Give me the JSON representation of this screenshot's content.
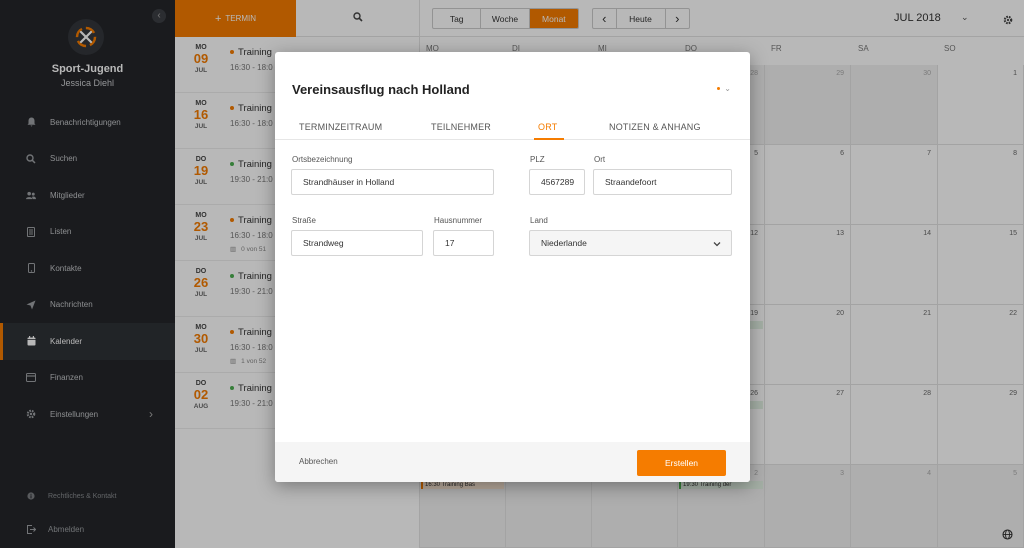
{
  "app": {
    "club_name": "Sport-Jugend",
    "user_name": "Jessica Diehl"
  },
  "sidebar": {
    "items": [
      {
        "label": "Benachrichtigungen",
        "icon": "bell-icon"
      },
      {
        "label": "Suchen",
        "icon": "search-icon"
      },
      {
        "label": "Mitglieder",
        "icon": "users-icon"
      },
      {
        "label": "Listen",
        "icon": "list-icon"
      },
      {
        "label": "Kontakte",
        "icon": "phone-icon"
      },
      {
        "label": "Nachrichten",
        "icon": "send-icon"
      },
      {
        "label": "Kalender",
        "icon": "calendar-icon",
        "active": true
      },
      {
        "label": "Finanzen",
        "icon": "finance-icon"
      },
      {
        "label": "Einstellungen",
        "icon": "gear-icon"
      }
    ],
    "footer_legal": "Rechtliches & Kontakt",
    "footer_logout": "Abmelden"
  },
  "event_list": {
    "add_label": "TERMIN",
    "items": [
      {
        "dow": "MO",
        "day": "09",
        "month": "JUL",
        "title": "Training",
        "time": "16:30 - 18:0",
        "meta": "",
        "color": "#f57c00"
      },
      {
        "dow": "MO",
        "day": "16",
        "month": "JUL",
        "title": "Training I",
        "time": "16:30 - 18:0",
        "meta": "",
        "color": "#f57c00"
      },
      {
        "dow": "DO",
        "day": "19",
        "month": "JUL",
        "title": "Training d",
        "time": "19:30 - 21:0",
        "meta": "",
        "color": "#4caf50"
      },
      {
        "dow": "MO",
        "day": "23",
        "month": "JUL",
        "title": "Training",
        "time": "16:30 - 18:0",
        "meta": "0 von 51",
        "color": "#f57c00"
      },
      {
        "dow": "DO",
        "day": "26",
        "month": "JUL",
        "title": "Training",
        "time": "19:30 - 21:0",
        "meta": "",
        "color": "#4caf50"
      },
      {
        "dow": "MO",
        "day": "30",
        "month": "JUL",
        "title": "Training",
        "time": "16:30 - 18:0",
        "meta": "1 von 52",
        "color": "#f57c00"
      },
      {
        "dow": "DO",
        "day": "02",
        "month": "AUG",
        "title": "Training",
        "time": "19:30 - 21:0",
        "meta": "",
        "color": "#4caf50"
      }
    ]
  },
  "calendar": {
    "views": [
      "Tag",
      "Woche",
      "Monat"
    ],
    "active_view": "Monat",
    "today_label": "Heute",
    "month_label": "JUL 2018",
    "weekdays": [
      "MO",
      "DI",
      "MI",
      "DO",
      "FR",
      "SA",
      "SO"
    ],
    "visible_dates": [
      "28",
      "29",
      "30",
      "1",
      "5",
      "6",
      "7",
      "8",
      "12",
      "13",
      "14",
      "15",
      "19",
      "20",
      "21",
      "22",
      "26",
      "27",
      "28",
      "29",
      "2",
      "3",
      "4",
      "5"
    ],
    "cell_events": [
      "16:30 Training Bas",
      "19:30 Training der"
    ]
  },
  "modal": {
    "title": "Vereinsausflug nach Holland",
    "tabs": [
      "TERMINZEITRAUM",
      "TEILNEHMER",
      "ORT",
      "NOTIZEN & ANHANG"
    ],
    "active_tab": "ORT",
    "fields": {
      "ortsbezeichnung": {
        "label": "Ortsbezeichnung",
        "value": "Strandhäuser in Holland"
      },
      "plz": {
        "label": "PLZ",
        "value": "4567289"
      },
      "ort": {
        "label": "Ort",
        "value": "Straandefoort"
      },
      "strasse": {
        "label": "Straße",
        "value": "Strandweg"
      },
      "hausnummer": {
        "label": "Hausnummer",
        "value": "17"
      },
      "land": {
        "label": "Land",
        "value": "Niederlande"
      }
    },
    "cancel_label": "Abbrechen",
    "create_label": "Erstellen"
  },
  "colors": {
    "accent": "#f57c00",
    "sidebar_bg": "#24262a",
    "green": "#4caf50"
  }
}
